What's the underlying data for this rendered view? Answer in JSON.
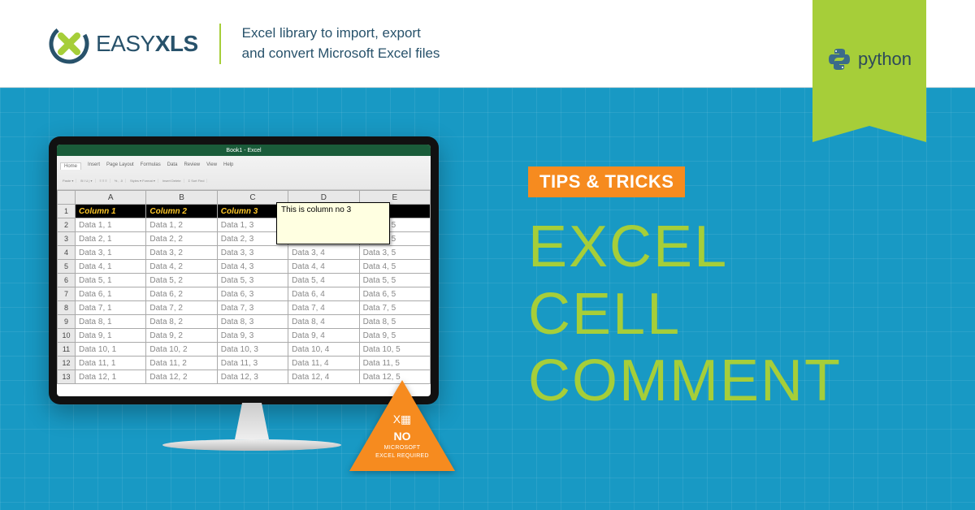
{
  "header": {
    "brand_prefix": "EASY",
    "brand_suffix": "XLS",
    "tagline_l1": "Excel library to import, export",
    "tagline_l2": "and convert Microsoft Excel files"
  },
  "ribbon": {
    "label": "python"
  },
  "monitor": {
    "title": "Book1 - Excel",
    "tabs": [
      "Home",
      "Insert",
      "Page Layout",
      "Formulas",
      "Data",
      "Review",
      "View",
      "Help"
    ],
    "col_letters": [
      "A",
      "B",
      "C",
      "D",
      "E"
    ],
    "header_row": [
      "Column 1",
      "Column 2",
      "Column 3",
      "",
      "n 5"
    ],
    "rows": [
      [
        "Data 1, 1",
        "Data 1, 2",
        "Data 1, 3",
        "",
        "Data 1, 5"
      ],
      [
        "Data 2, 1",
        "Data 2, 2",
        "Data 2, 3",
        "",
        "Data 2, 5"
      ],
      [
        "Data 3, 1",
        "Data 3, 2",
        "Data 3, 3",
        "Data 3, 4",
        "Data 3, 5"
      ],
      [
        "Data 4, 1",
        "Data 4, 2",
        "Data 4, 3",
        "Data 4, 4",
        "Data 4, 5"
      ],
      [
        "Data 5, 1",
        "Data 5, 2",
        "Data 5, 3",
        "Data 5, 4",
        "Data 5, 5"
      ],
      [
        "Data 6, 1",
        "Data 6, 2",
        "Data 6, 3",
        "Data 6, 4",
        "Data 6, 5"
      ],
      [
        "Data 7, 1",
        "Data 7, 2",
        "Data 7, 3",
        "Data 7, 4",
        "Data 7, 5"
      ],
      [
        "Data 8, 1",
        "Data 8, 2",
        "Data 8, 3",
        "Data 8, 4",
        "Data 8, 5"
      ],
      [
        "Data 9, 1",
        "Data 9, 2",
        "Data 9, 3",
        "Data 9, 4",
        "Data 9, 5"
      ],
      [
        "Data 10, 1",
        "Data 10, 2",
        "Data 10, 3",
        "Data 10, 4",
        "Data 10, 5"
      ],
      [
        "Data 11, 1",
        "Data 11, 2",
        "Data 11, 3",
        "Data 11, 4",
        "Data 11, 5"
      ],
      [
        "Data 12, 1",
        "Data 12, 2",
        "Data 12, 3",
        "Data 12, 4",
        "Data 12, 5"
      ]
    ],
    "comment": "This is column no 3"
  },
  "badge": {
    "icon": "X▦",
    "no": "NO",
    "line1": "MICROSOFT",
    "line2": "EXCEL REQUIRED"
  },
  "copy": {
    "tag": "TIPS & TRICKS",
    "h1": "EXCEL",
    "h2": "CELL",
    "h3": "COMMENT"
  }
}
